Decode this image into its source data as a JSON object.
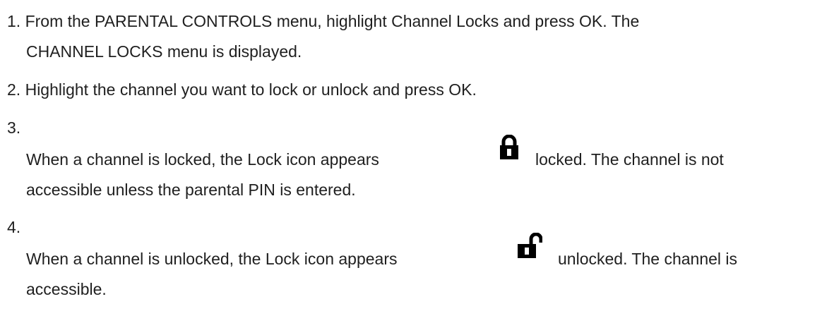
{
  "steps": [
    {
      "number": "1.",
      "lines": [
        "From the PARENTAL CONTROLS menu, highlight Channel Locks and press OK. The",
        "CHANNEL LOCKS menu is displayed."
      ]
    },
    {
      "number": "2.",
      "lines": [
        "Highlight the channel you want to lock or unlock and press OK."
      ]
    },
    {
      "number": "3.",
      "before_icon": "When a channel is locked, the Lock icon appears",
      "icon": "lock-closed-icon",
      "after_icon": "locked. The channel is not",
      "continuation": "accessible unless the parental PIN is entered."
    },
    {
      "number": "4.",
      "before_icon": "When a channel is unlocked, the Lock icon appears",
      "icon": "lock-open-icon",
      "after_icon": "unlocked. The channel is",
      "continuation": "accessible."
    }
  ]
}
